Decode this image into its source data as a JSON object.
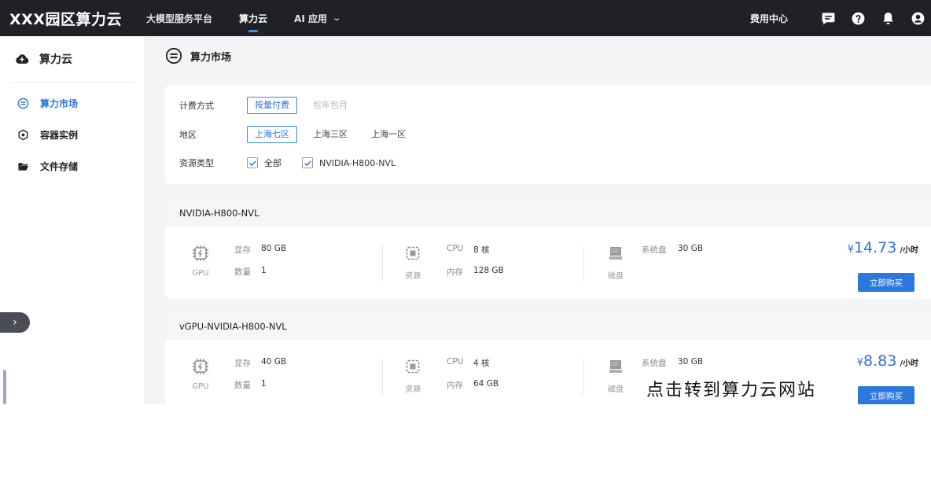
{
  "app": {
    "brand": "XXX园区算力云",
    "nav": [
      {
        "label": "大模型服务平台"
      },
      {
        "label": "算力云"
      },
      {
        "label": "AI 应用"
      }
    ],
    "fee_center": "费用中心",
    "accent": "#2c73d9"
  },
  "sidebar": {
    "title": "算力云",
    "items": [
      {
        "label": "算力市场",
        "icon": "market-icon"
      },
      {
        "label": "容器实例",
        "icon": "container-icon"
      },
      {
        "label": "文件存储",
        "icon": "folder-icon"
      }
    ],
    "collapse": "›"
  },
  "main": {
    "title": "算力市场",
    "filters": {
      "billing": {
        "label": "计费方式",
        "options": [
          "按量付费",
          "包年包月"
        ]
      },
      "region": {
        "label": "地区",
        "options": [
          "上海七区",
          "上海三区",
          "上海一区"
        ]
      },
      "resource": {
        "label": "资源类型",
        "options": [
          "全部",
          "NVIDIA-H800-NVL"
        ]
      }
    },
    "cards": [
      {
        "name": "NVIDIA-H800-NVL",
        "gpu_caption": "GPU",
        "vram_label": "显存",
        "vram": "80 GB",
        "count_label": "数量",
        "count": "1",
        "res_caption": "资源",
        "cpu_label": "CPU",
        "cpu": "8 核",
        "mem_label": "内存",
        "mem": "128 GB",
        "disk_caption": "磁盘",
        "disk_label": "系统盘",
        "disk": "30 GB",
        "currency": "¥",
        "price": "14.73",
        "unit": "/小时",
        "buy": "立即购买"
      },
      {
        "name": "vGPU-NVIDIA-H800-NVL",
        "gpu_caption": "GPU",
        "vram_label": "显存",
        "vram": "40 GB",
        "count_label": "数量",
        "count": "1",
        "res_caption": "资源",
        "cpu_label": "CPU",
        "cpu": "4 核",
        "mem_label": "内存",
        "mem": "64 GB",
        "disk_caption": "磁盘",
        "disk_label": "系统盘",
        "disk": "30 GB",
        "currency": "¥",
        "price": "8.83",
        "unit": "/小时",
        "buy": "立即购买"
      }
    ]
  },
  "overlay_caption": "点击转到算力云网站"
}
